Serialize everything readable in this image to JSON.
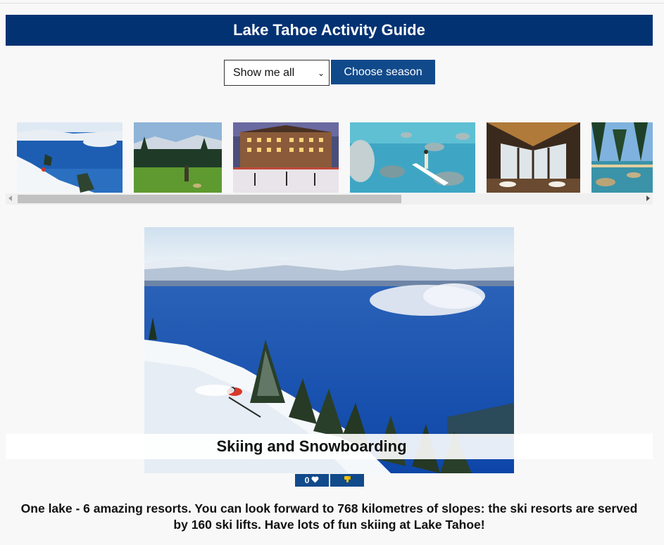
{
  "header": {
    "title": "Lake Tahoe Activity Guide"
  },
  "controls": {
    "season_select_value": "Show me all",
    "choose_button_label": "Choose season"
  },
  "gallery": {
    "thumbnails": [
      {
        "name": "skiing"
      },
      {
        "name": "meadow-hiking"
      },
      {
        "name": "resort-ice-rink"
      },
      {
        "name": "paddleboarding"
      },
      {
        "name": "lodge-dining"
      },
      {
        "name": "lake-shore"
      }
    ]
  },
  "feature": {
    "caption": "Skiing and Snowboarding",
    "like_count": "0",
    "like_icon": "heart-icon",
    "dislike_icon": "thumbs-down-icon",
    "description": "One lake - 6 amazing resorts. You can look forward to 768 kilometres of slopes: the ski resorts are served by 160 ski lifts. Have lots of fun skiing at Lake Tahoe!"
  },
  "colors": {
    "brand_blue": "#033273",
    "button_blue": "#114a8b",
    "dislike_yellow": "#f2c200"
  }
}
